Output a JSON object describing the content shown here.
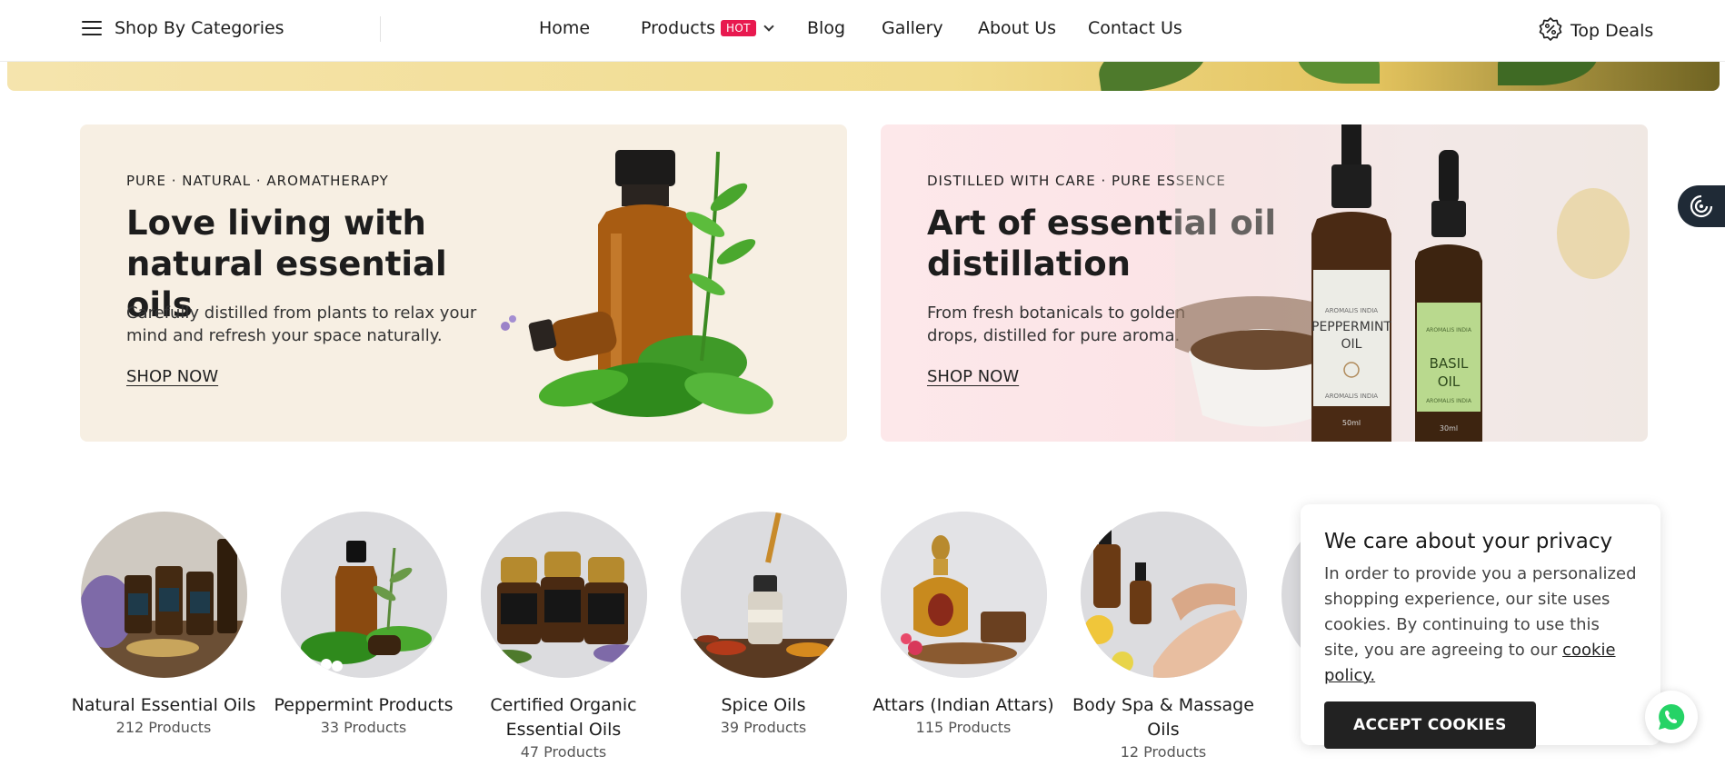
{
  "header": {
    "categories_label": "Shop By Categories",
    "nav": [
      {
        "label": "Home"
      },
      {
        "label": "Products",
        "badge": "HOT"
      },
      {
        "label": "Blog"
      },
      {
        "label": "Gallery"
      },
      {
        "label": "About Us"
      },
      {
        "label": "Contact Us"
      }
    ],
    "deals_label": "Top Deals"
  },
  "banners": [
    {
      "eyebrow": "PURE · NATURAL · AROMATHERAPY",
      "title": "Love living with natural essential oils",
      "text": "Carefully distilled from plants to relax your mind and refresh your space naturally.",
      "link": "SHOP NOW"
    },
    {
      "eyebrow": "DISTILLED WITH CARE · PURE ESSENCE",
      "title": "Art of essential oil distillation",
      "text": "From fresh botanicals to golden drops, distilled for pure aroma.",
      "link": "SHOP NOW",
      "bottle_labels": {
        "brand": "AROMALIS INDIA",
        "peppermint": "PEPPERMINT OIL",
        "peppermint_size": "50ml",
        "basil": "BASIL OIL",
        "basil_size": "30ml"
      }
    }
  ],
  "categories": [
    {
      "name": "Natural Essential Oils",
      "count": "212 Products"
    },
    {
      "name": "Peppermint Products",
      "count": "33 Products"
    },
    {
      "name": "Certified Organic Essential Oils",
      "count": "47 Products"
    },
    {
      "name": "Spice Oils",
      "count": "39 Products"
    },
    {
      "name": "Attars (Indian Attars)",
      "count": "115 Products"
    },
    {
      "name": "Body Spa & Massage Oils",
      "count": "12 Products"
    }
  ],
  "cookie": {
    "title": "We care about your privacy",
    "text": "In order to provide you a personalized shopping experience, our site uses cookies. By continuing to use this site, you are agreeing to our",
    "link": "cookie policy.",
    "button": "ACCEPT COOKIES"
  },
  "colors": {
    "hot_badge": "#e8194f",
    "banner_1_bg": "#f7efe3",
    "banner_2_bg": "#fde8ea",
    "button_dark": "#222222",
    "whatsapp": "#25d366"
  },
  "icons": {
    "menu": "hamburger-icon",
    "deals": "percent-badge-icon",
    "side": "target-icon",
    "chat": "whatsapp-icon"
  }
}
